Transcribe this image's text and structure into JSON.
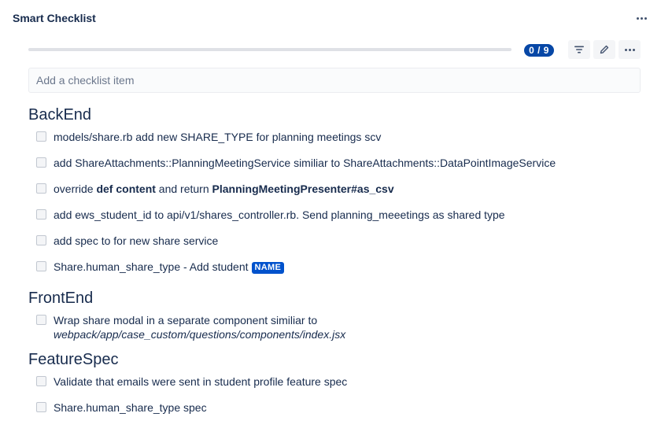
{
  "panel": {
    "title": "Smart Checklist",
    "more_icon": "more-horizontal-icon"
  },
  "progress": {
    "completed": 0,
    "total": 9,
    "label": "0 / 9",
    "fraction": 0
  },
  "toolbar": {
    "filter_icon": "filter-icon",
    "edit_icon": "pencil-icon",
    "more_icon": "more-horizontal-icon"
  },
  "add_item": {
    "placeholder": "Add a checklist item",
    "value": ""
  },
  "sections": [
    {
      "heading": "BackEnd",
      "items": [
        {
          "text": "models/share.rb add new SHARE_TYPE for planning meetings scv"
        },
        {
          "text": "add ShareAttachments::PlanningMeetingService similiar to ShareAttachments::DataPointImageService"
        },
        {
          "pre": "override ",
          "bold1": "def content",
          "mid": " and return ",
          "bold2": "PlanningMeetingPresenter#as_csv"
        },
        {
          "text": "add ews_student_id to api/v1/shares_controller.rb. Send planning_meeetings as shared type"
        },
        {
          "text": "add spec to for new share service"
        },
        {
          "text": "Share.human_share_type - Add student",
          "badge": "NAME"
        }
      ]
    },
    {
      "heading": "FrontEnd",
      "items": [
        {
          "line1": "Wrap share modal in a separate component similiar to",
          "line2": "webpack/app/case_custom/questions/components/index.jsx"
        }
      ]
    },
    {
      "heading": "FeatureSpec",
      "items": [
        {
          "text": "Validate that emails were sent in student profile feature spec"
        },
        {
          "text": "Share.human_share_type spec"
        }
      ]
    }
  ],
  "colors": {
    "badge_bg": "#0747a6",
    "lozenge_bg": "#0052cc",
    "text": "#172b4d"
  }
}
